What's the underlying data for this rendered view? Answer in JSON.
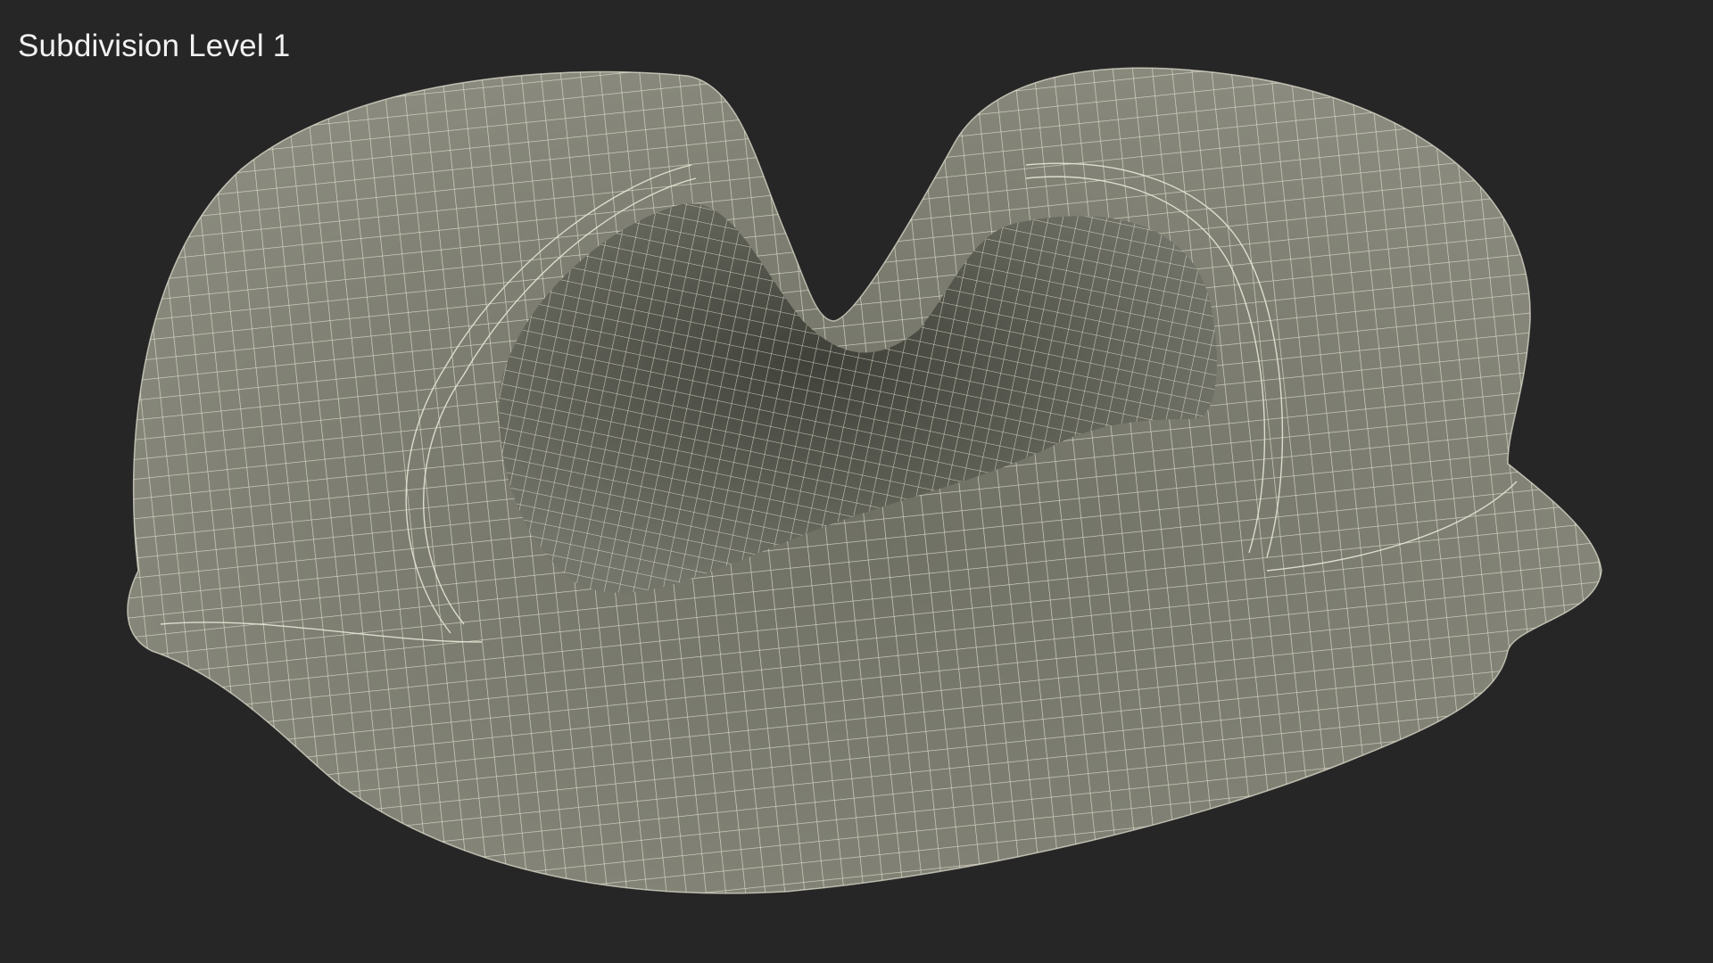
{
  "viewport": {
    "label": "Subdivision Level 1",
    "background": "#262626",
    "mesh_fill": "#7b7c6e",
    "mesh_shadow": "#4f5046",
    "wire_color": "#e8e6d6"
  }
}
